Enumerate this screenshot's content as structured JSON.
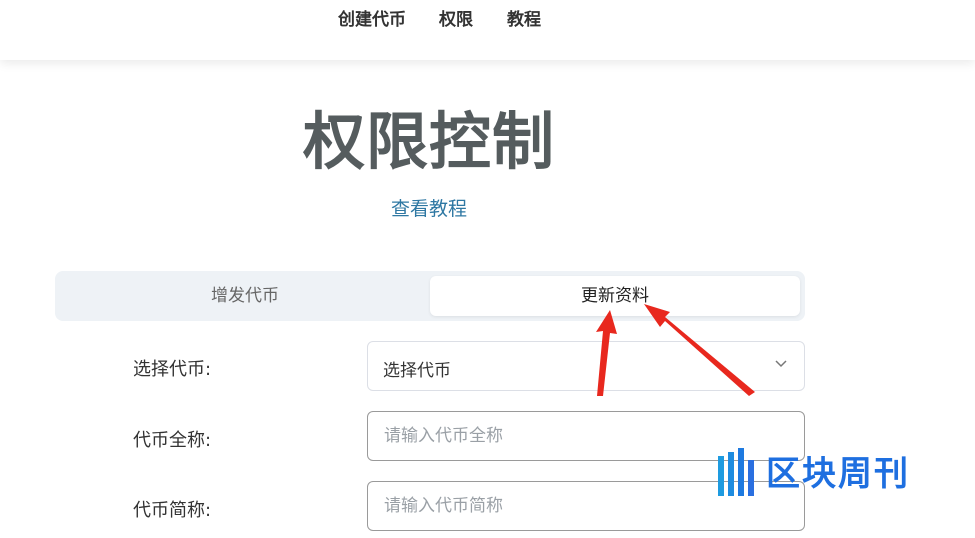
{
  "nav": {
    "items": [
      "创建代币",
      "权限",
      "教程"
    ]
  },
  "page": {
    "title": "权限控制",
    "tutorial_link": "查看教程"
  },
  "tabs": [
    {
      "label": "增发代币",
      "active": false
    },
    {
      "label": "更新资料",
      "active": true
    }
  ],
  "form": {
    "select_token": {
      "label": "选择代币:",
      "value": "选择代币"
    },
    "full_name": {
      "label": "代币全称:",
      "placeholder": "请输入代币全称"
    },
    "short_name": {
      "label": "代币简称:",
      "placeholder": "请输入代币简称"
    }
  },
  "watermark": {
    "text": "区块周刊"
  },
  "colors": {
    "link": "#2f78a3",
    "title": "#555c5e",
    "arrow": "#e8281e",
    "watermark": "#1e6fe0"
  }
}
